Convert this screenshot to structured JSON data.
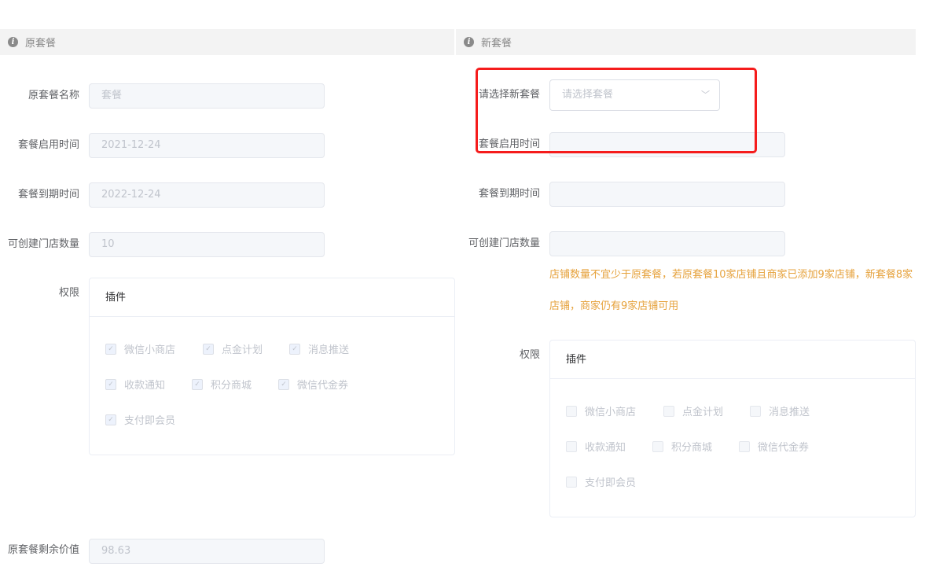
{
  "left": {
    "title": "原套餐",
    "fields": [
      {
        "label": "原套餐名称",
        "value": "套餐"
      },
      {
        "label": "套餐启用时间",
        "value": "2021-12-24"
      },
      {
        "label": "套餐到期时间",
        "value": "2022-12-24"
      },
      {
        "label": "可创建门店数量",
        "value": "10"
      }
    ],
    "perm_label": "权限",
    "card_title": "插件",
    "plugins": [
      "微信小商店",
      "点金计划",
      "消息推送",
      "收款通知",
      "积分商城",
      "微信代金券",
      "支付即会员"
    ],
    "remain_label": "原套餐剩余价值",
    "remain_value": "98.63"
  },
  "right": {
    "title": "新套餐",
    "select_label": "请选择新套餐",
    "select_placeholder": "请选择套餐",
    "fields": [
      {
        "label": "套餐启用时间",
        "value": ""
      },
      {
        "label": "套餐到期时间",
        "value": ""
      },
      {
        "label": "可创建门店数量",
        "value": ""
      }
    ],
    "warning": "店铺数量不宜少于原套餐，若原套餐10家店铺且商家已添加9家店铺，新套餐8家店铺，商家仍有9家店铺可用",
    "perm_label": "权限",
    "card_title": "插件",
    "plugins": [
      "微信小商店",
      "点金计划",
      "消息推送",
      "收款通知",
      "积分商城",
      "微信代金券",
      "支付即会员"
    ]
  },
  "colors": {
    "warning": "#e6a23c",
    "highlight": "#f51c1c"
  }
}
